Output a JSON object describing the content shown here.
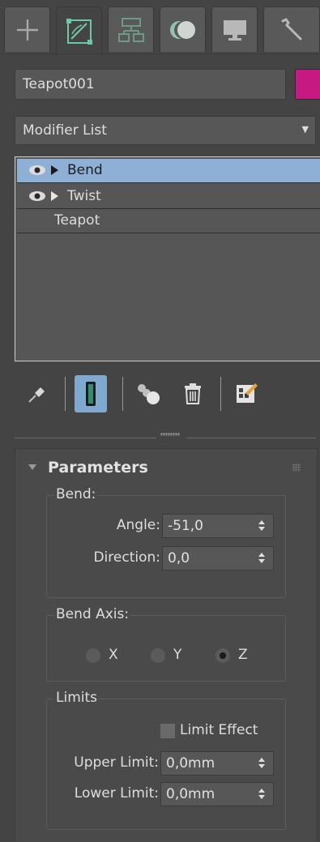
{
  "tabs": [
    {
      "id": "create",
      "icon": "plus-icon"
    },
    {
      "id": "modify",
      "icon": "modify-icon",
      "active": true
    },
    {
      "id": "hierarchy",
      "icon": "hierarchy-icon"
    },
    {
      "id": "motion",
      "icon": "motion-icon"
    },
    {
      "id": "display",
      "icon": "display-icon"
    },
    {
      "id": "utilities",
      "icon": "wrench-icon"
    }
  ],
  "object": {
    "name": "Teapot001",
    "color": "#c61a82"
  },
  "modifier_list": {
    "label": "Modifier List"
  },
  "stack": {
    "items": [
      {
        "label": "Bend",
        "selected": true
      },
      {
        "label": "Twist",
        "selected": false
      },
      {
        "label": "Teapot",
        "selected": false
      }
    ]
  },
  "toolbar": {
    "icons": [
      "pin-stack-icon",
      "show-end-result-icon",
      "make-unique-icon",
      "remove-modifier-icon",
      "configure-modifier-sets-icon"
    ]
  },
  "parameters": {
    "title": "Parameters",
    "bend_group": {
      "label": "Bend:",
      "angle_label": "Angle:",
      "angle_value": "-51,0",
      "direction_label": "Direction:",
      "direction_value": "0,0"
    },
    "bend_axis": {
      "label": "Bend Axis:",
      "options": [
        "X",
        "Y",
        "Z"
      ],
      "selected": "Z"
    },
    "limits": {
      "label": "Limits",
      "limit_effect_label": "Limit Effect",
      "limit_effect_checked": false,
      "upper_label": "Upper Limit:",
      "upper_value": "0,0mm",
      "lower_label": "Lower Limit:",
      "lower_value": "0,0mm"
    }
  }
}
